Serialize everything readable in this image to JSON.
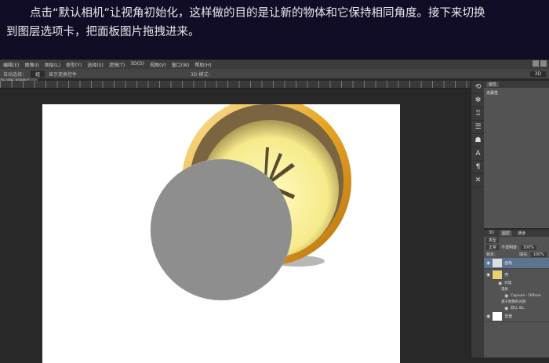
{
  "banner": {
    "line1": "点击“默认相机”让视角初始化，这样做的目的是让新的物体和它保持相同角度。接下来切换",
    "line2": "到图层选项卡，把面板图片拖拽进来。"
  },
  "menu": [
    "编辑(E)",
    "图像(I)",
    "图层(L)",
    "类型(Y)",
    "选择(S)",
    "滤镜(T)",
    "3D(D)",
    "视图(V)",
    "窗口(W)",
    "帮助(H)"
  ],
  "options": {
    "auto_select": "自动选择：",
    "select_value": "组",
    "show_transform": "显示变换控件",
    "mode3d": "3D 模式：",
    "right_value": "3D"
  },
  "doc_tab": "1% (面板, RGB/8) *",
  "properties": {
    "tab": "属性",
    "title": "无属性"
  },
  "layers": {
    "tabs": [
      "3D",
      "图层",
      "通道"
    ],
    "filter": "类型",
    "blend": "正常",
    "opacity_label": "不透明度:",
    "opacity": "100%",
    "lock_label": "锁定:",
    "fill_label": "填充:",
    "fill": "100%",
    "items": [
      {
        "name": "面板"
      },
      {
        "name": "壳"
      },
      {
        "name": "背景"
      }
    ],
    "sub": [
      "纹理",
      "漫射",
      "Capsule - Diffuse",
      "基于图像的光照",
      "默认 IBL"
    ]
  },
  "colors": {
    "banner": "#110d26",
    "gold": "#e8a627",
    "selected": "#5d7491"
  }
}
